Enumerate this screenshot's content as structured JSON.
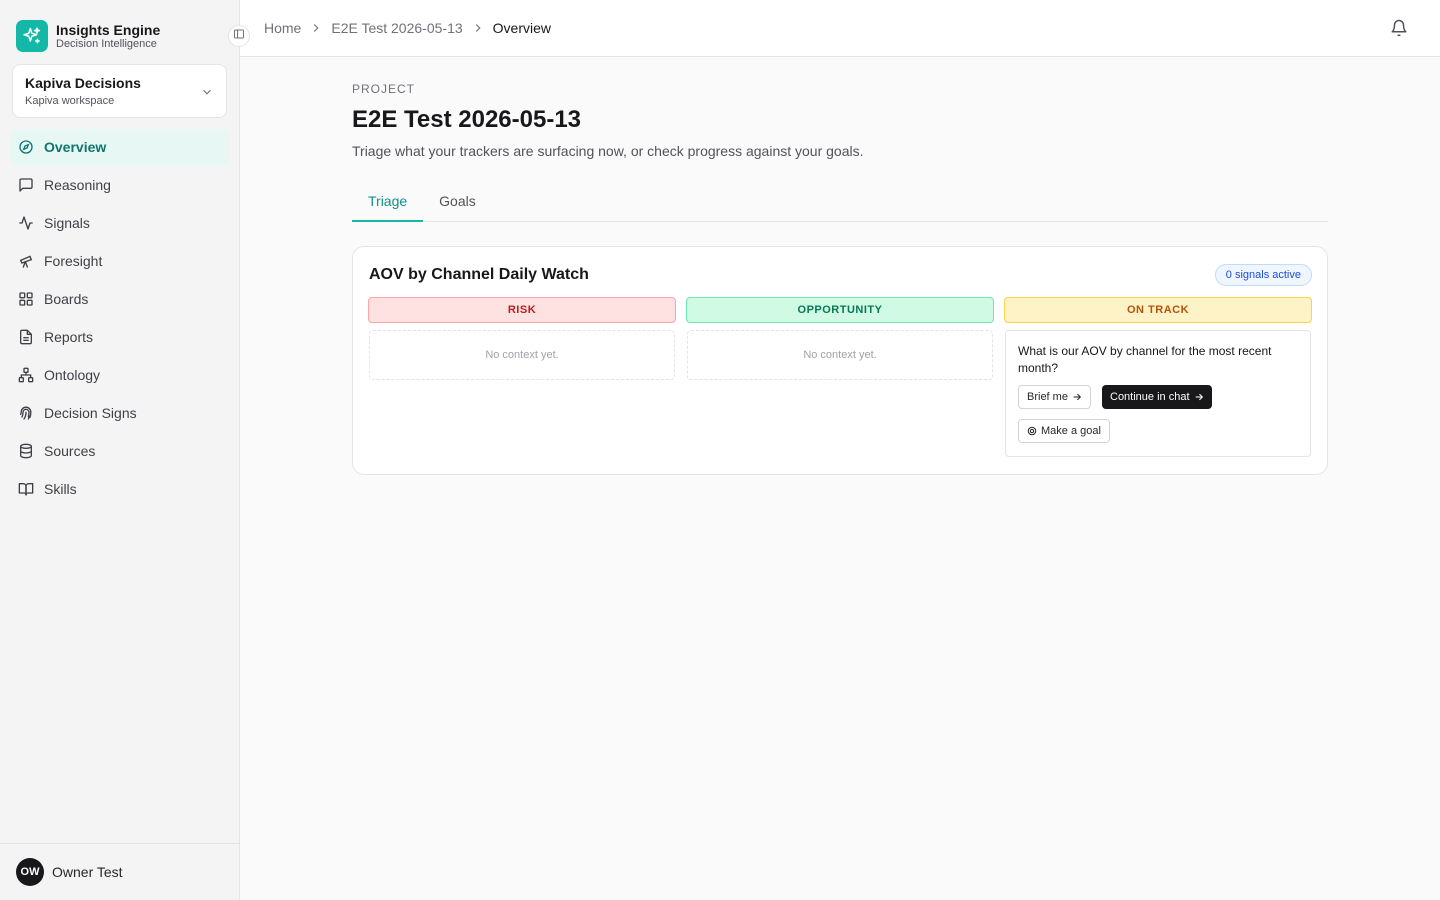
{
  "brand": {
    "name": "Insights Engine",
    "subtitle": "Decision Intelligence"
  },
  "workspace": {
    "name": "Kapiva Decisions",
    "subtitle": "Kapiva workspace"
  },
  "nav": [
    {
      "label": "Overview",
      "icon": "compass-icon",
      "active": true
    },
    {
      "label": "Reasoning",
      "icon": "message-square-icon"
    },
    {
      "label": "Signals",
      "icon": "activity-icon"
    },
    {
      "label": "Foresight",
      "icon": "telescope-icon"
    },
    {
      "label": "Boards",
      "icon": "grid-icon"
    },
    {
      "label": "Reports",
      "icon": "file-text-icon"
    },
    {
      "label": "Ontology",
      "icon": "network-icon"
    },
    {
      "label": "Decision Signs",
      "icon": "fingerprint-icon"
    },
    {
      "label": "Sources",
      "icon": "database-icon"
    },
    {
      "label": "Skills",
      "icon": "book-open-icon"
    }
  ],
  "user": {
    "initials": "OW",
    "name": "Owner Test"
  },
  "breadcrumb": [
    "Home",
    "E2E Test 2026-05-13",
    "Overview"
  ],
  "page": {
    "eyebrow": "PROJECT",
    "title": "E2E Test 2026-05-13",
    "subtitle": "Triage what your trackers are surfacing now, or check progress against your goals."
  },
  "tabs": [
    {
      "label": "Triage",
      "active": true
    },
    {
      "label": "Goals",
      "active": false
    }
  ],
  "tracker": {
    "title": "AOV by Channel Daily Watch",
    "badge": "0 signals active",
    "columns": {
      "risk": {
        "label": "RISK",
        "empty_text": "No context yet."
      },
      "opportunity": {
        "label": "OPPORTUNITY",
        "empty_text": "No context yet."
      },
      "on_track": {
        "label": "ON TRACK",
        "question": "What is our AOV by channel for the most recent month?",
        "brief_label": "Brief me",
        "continue_label": "Continue in chat",
        "goal_label": "Make a goal"
      }
    }
  },
  "colors": {
    "accent": "#14b8a6",
    "accent_text": "#0d9488",
    "risk": "#b91c1c",
    "opportunity": "#047857",
    "on_track": "#b45309"
  }
}
